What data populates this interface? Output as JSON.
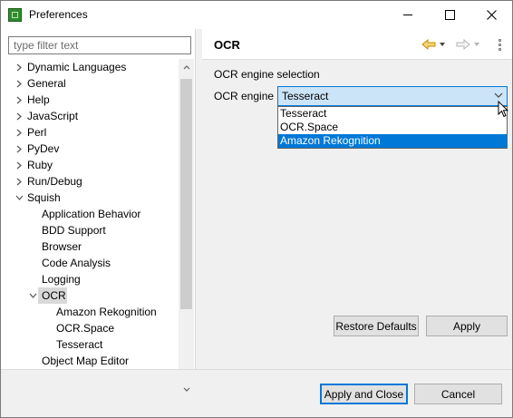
{
  "window": {
    "title": "Preferences",
    "icon": "squish-app-icon",
    "controls": [
      "minimize",
      "maximize",
      "close"
    ]
  },
  "filter": {
    "placeholder": "type filter text",
    "value": ""
  },
  "tree": {
    "items": [
      {
        "label": "Dynamic Languages",
        "level": 0,
        "expanded": false,
        "has_children": true
      },
      {
        "label": "General",
        "level": 0,
        "expanded": false,
        "has_children": true
      },
      {
        "label": "Help",
        "level": 0,
        "expanded": false,
        "has_children": true
      },
      {
        "label": "JavaScript",
        "level": 0,
        "expanded": false,
        "has_children": true
      },
      {
        "label": "Perl",
        "level": 0,
        "expanded": false,
        "has_children": true
      },
      {
        "label": "PyDev",
        "level": 0,
        "expanded": false,
        "has_children": true
      },
      {
        "label": "Ruby",
        "level": 0,
        "expanded": false,
        "has_children": true
      },
      {
        "label": "Run/Debug",
        "level": 0,
        "expanded": false,
        "has_children": true
      },
      {
        "label": "Squish",
        "level": 0,
        "expanded": true,
        "has_children": true
      },
      {
        "label": "Application Behavior",
        "level": 1,
        "has_children": false
      },
      {
        "label": "BDD Support",
        "level": 1,
        "has_children": false
      },
      {
        "label": "Browser",
        "level": 1,
        "has_children": false
      },
      {
        "label": "Code Analysis",
        "level": 1,
        "has_children": false
      },
      {
        "label": "Logging",
        "level": 1,
        "has_children": false
      },
      {
        "label": "OCR",
        "level": 1,
        "expanded": true,
        "has_children": true,
        "selected": true
      },
      {
        "label": "Amazon Rekognition",
        "level": 2,
        "has_children": false
      },
      {
        "label": "OCR.Space",
        "level": 2,
        "has_children": false
      },
      {
        "label": "Tesseract",
        "level": 2,
        "has_children": false
      },
      {
        "label": "Object Map Editor",
        "level": 1,
        "has_children": false
      }
    ]
  },
  "page": {
    "title": "OCR",
    "section_label": "OCR engine selection",
    "field_label": "OCR engine",
    "selected_value": "Tesseract",
    "options": [
      {
        "label": "Tesseract",
        "highlighted": false
      },
      {
        "label": "OCR.Space",
        "highlighted": false
      },
      {
        "label": "Amazon Rekognition",
        "highlighted": true
      }
    ],
    "restore_defaults_label": "Restore Defaults",
    "apply_label": "Apply"
  },
  "footer": {
    "apply_and_close_label": "Apply and Close",
    "cancel_label": "Cancel"
  },
  "colors": {
    "selection": "#0078d7",
    "tree_selection": "#d9d9d9",
    "nav_back_arrow": "#e8a317",
    "nav_fwd_arrow_disabled": "#b5b5b5"
  }
}
